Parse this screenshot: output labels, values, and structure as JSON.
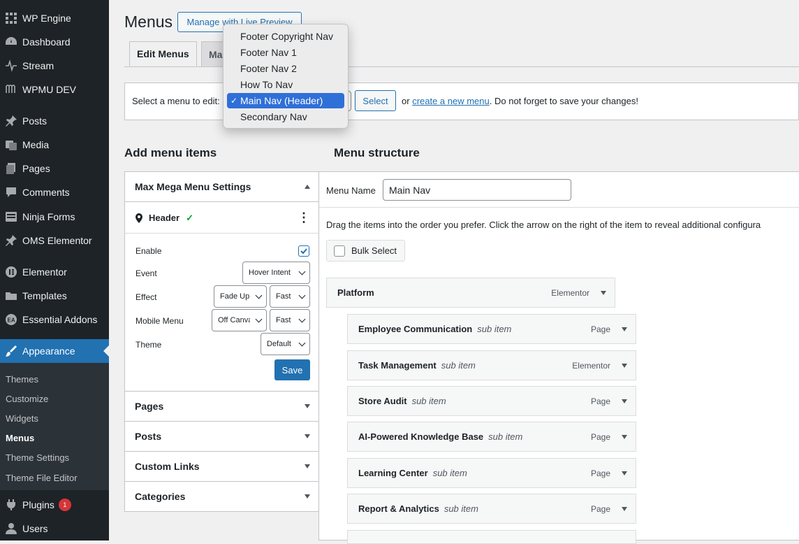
{
  "sidebar": {
    "items": [
      {
        "label": "WP Engine",
        "icon": "wp-engine-icon"
      },
      {
        "label": "Dashboard",
        "icon": "dashboard-icon"
      },
      {
        "label": "Stream",
        "icon": "stream-icon"
      },
      {
        "label": "WPMU DEV",
        "icon": "wpmu-dev-icon"
      },
      {
        "label": "Posts",
        "icon": "pin-icon"
      },
      {
        "label": "Media",
        "icon": "media-icon"
      },
      {
        "label": "Pages",
        "icon": "pages-icon"
      },
      {
        "label": "Comments",
        "icon": "comment-icon"
      },
      {
        "label": "Ninja Forms",
        "icon": "forms-icon"
      },
      {
        "label": "OMS Elementor",
        "icon": "pin-icon"
      },
      {
        "label": "Elementor",
        "icon": "elementor-icon"
      },
      {
        "label": "Templates",
        "icon": "folder-icon"
      },
      {
        "label": "Essential Addons",
        "icon": "ea-icon"
      },
      {
        "label": "Appearance",
        "icon": "brush-icon"
      }
    ],
    "submenu": [
      "Themes",
      "Customize",
      "Widgets",
      "Menus",
      "Theme Settings",
      "Theme File Editor"
    ],
    "after": [
      {
        "label": "Plugins",
        "icon": "plug-icon",
        "badge": "1"
      },
      {
        "label": "Users",
        "icon": "user-icon"
      }
    ]
  },
  "page": {
    "title": "Menus",
    "live_preview_button": "Manage with Live Preview",
    "tabs": [
      "Edit Menus",
      "Ma"
    ],
    "select_prefix": "Select a menu to edit:",
    "select_button": "Select",
    "or_text": "or",
    "create_link": "create a new menu",
    "save_note": ". Do not forget to save your changes!"
  },
  "dropdown": {
    "options": [
      "Footer Copyright Nav",
      "Footer Nav 1",
      "Footer Nav 2",
      "How To Nav",
      "Main Nav (Header)",
      "Secondary Nav"
    ],
    "selected": "Main Nav (Header)",
    "check": "✓"
  },
  "add_items": {
    "heading": "Add menu items",
    "mega": {
      "title": "Max Mega Menu Settings",
      "location": "Header",
      "location_check": "✓",
      "more": "⋮",
      "rows": {
        "enable": "Enable",
        "event": "Event",
        "event_value": "Hover Intent",
        "effect": "Effect",
        "effect_value": "Fade Up",
        "effect_speed": "Fast",
        "mobile": "Mobile Menu",
        "mobile_value": "Off Canvas",
        "mobile_speed": "Fast",
        "theme": "Theme",
        "theme_value": "Default"
      },
      "save": "Save"
    },
    "sections": [
      "Pages",
      "Posts",
      "Custom Links",
      "Categories"
    ]
  },
  "structure": {
    "heading": "Menu structure",
    "name_label": "Menu Name",
    "name_value": "Main Nav",
    "hint": "Drag the items into the order you prefer. Click the arrow on the right of the item to reveal additional configura",
    "bulk": "Bulk Select",
    "top": {
      "name": "Platform",
      "type": "Elementor"
    },
    "children": [
      {
        "name": "Employee Communication",
        "sub": "sub item",
        "type": "Page"
      },
      {
        "name": "Task Management",
        "sub": "sub item",
        "type": "Elementor"
      },
      {
        "name": "Store Audit",
        "sub": "sub item",
        "type": "Page"
      },
      {
        "name": "AI-Powered Knowledge Base",
        "sub": "sub item",
        "type": "Page"
      },
      {
        "name": "Learning Center",
        "sub": "sub item",
        "type": "Page"
      },
      {
        "name": "Report & Analytics",
        "sub": "sub item",
        "type": "Page"
      }
    ]
  },
  "colors": {
    "sidebar": "#1d2327",
    "accent": "#2271b1",
    "badge": "#d63638"
  }
}
